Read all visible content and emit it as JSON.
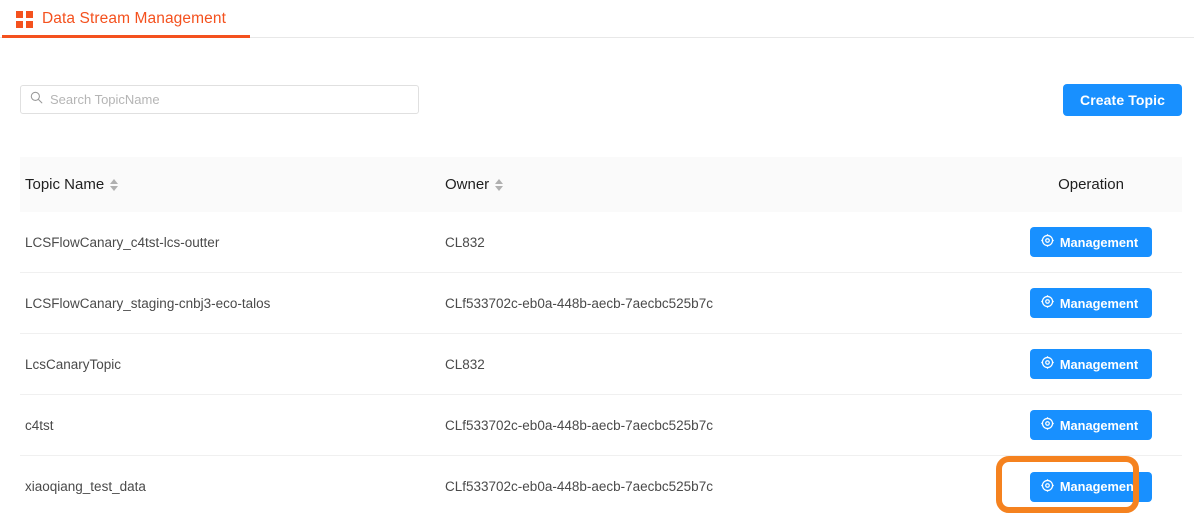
{
  "tab": {
    "label": "Data Stream Management",
    "icon": "grid-squares-icon",
    "accent_color": "#f4511e"
  },
  "toolbar": {
    "search": {
      "placeholder": "Search TopicName",
      "value": "",
      "icon": "search-icon"
    },
    "create_button": {
      "label": "Create Topic",
      "color": "#1890ff"
    }
  },
  "table": {
    "columns": [
      {
        "label": "Topic Name",
        "sortable": true
      },
      {
        "label": "Owner",
        "sortable": true
      },
      {
        "label": "Operation",
        "sortable": false
      }
    ],
    "rows": [
      {
        "topic_name": "LCSFlowCanary_c4tst-lcs-outter",
        "owner": "CL832",
        "action_label": "Management",
        "action_icon": "gear-icon",
        "highlighted": false
      },
      {
        "topic_name": "LCSFlowCanary_staging-cnbj3-eco-talos",
        "owner": "CLf533702c-eb0a-448b-aecb-7aecbc525b7c",
        "action_label": "Management",
        "action_icon": "gear-icon",
        "highlighted": false
      },
      {
        "topic_name": "LcsCanaryTopic",
        "owner": "CL832",
        "action_label": "Management",
        "action_icon": "gear-icon",
        "highlighted": false
      },
      {
        "topic_name": "c4tst",
        "owner": "CLf533702c-eb0a-448b-aecb-7aecbc525b7c",
        "action_label": "Management",
        "action_icon": "gear-icon",
        "highlighted": false
      },
      {
        "topic_name": "xiaoqiang_test_data",
        "owner": "CLf533702c-eb0a-448b-aecb-7aecbc525b7c",
        "action_label": "Management",
        "action_icon": "gear-icon",
        "highlighted": true
      }
    ]
  },
  "annotation": {
    "type": "highlight-rectangle",
    "color": "#f5821f",
    "target": "management-button-row-5"
  }
}
